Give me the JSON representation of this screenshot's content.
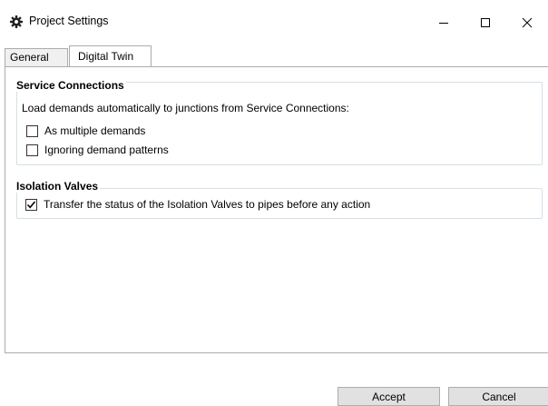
{
  "window": {
    "title": "Project Settings",
    "icon": "gear-icon",
    "controls": {
      "minimize": "minimize-icon",
      "maximize": "maximize-icon",
      "close": "close-icon"
    }
  },
  "tabs": [
    {
      "label": "General",
      "selected": false
    },
    {
      "label": "Digital Twin",
      "selected": true
    }
  ],
  "service_connections": {
    "header": "Service Connections",
    "description": "Load demands automatically to junctions from Service Connections:",
    "options": [
      {
        "label": "As multiple demands",
        "checked": false
      },
      {
        "label": "Ignoring demand patterns",
        "checked": false
      }
    ]
  },
  "isolation_valves": {
    "header": "Isolation Valves",
    "options": [
      {
        "label": "Transfer the status of the Isolation Valves to pipes before any action",
        "checked": true
      }
    ]
  },
  "buttons": {
    "accept": "Accept",
    "cancel": "Cancel"
  },
  "colors": {
    "group_border": "#d5dfe5",
    "tab_border": "#acacac",
    "button_bg": "#e1e1e1"
  }
}
